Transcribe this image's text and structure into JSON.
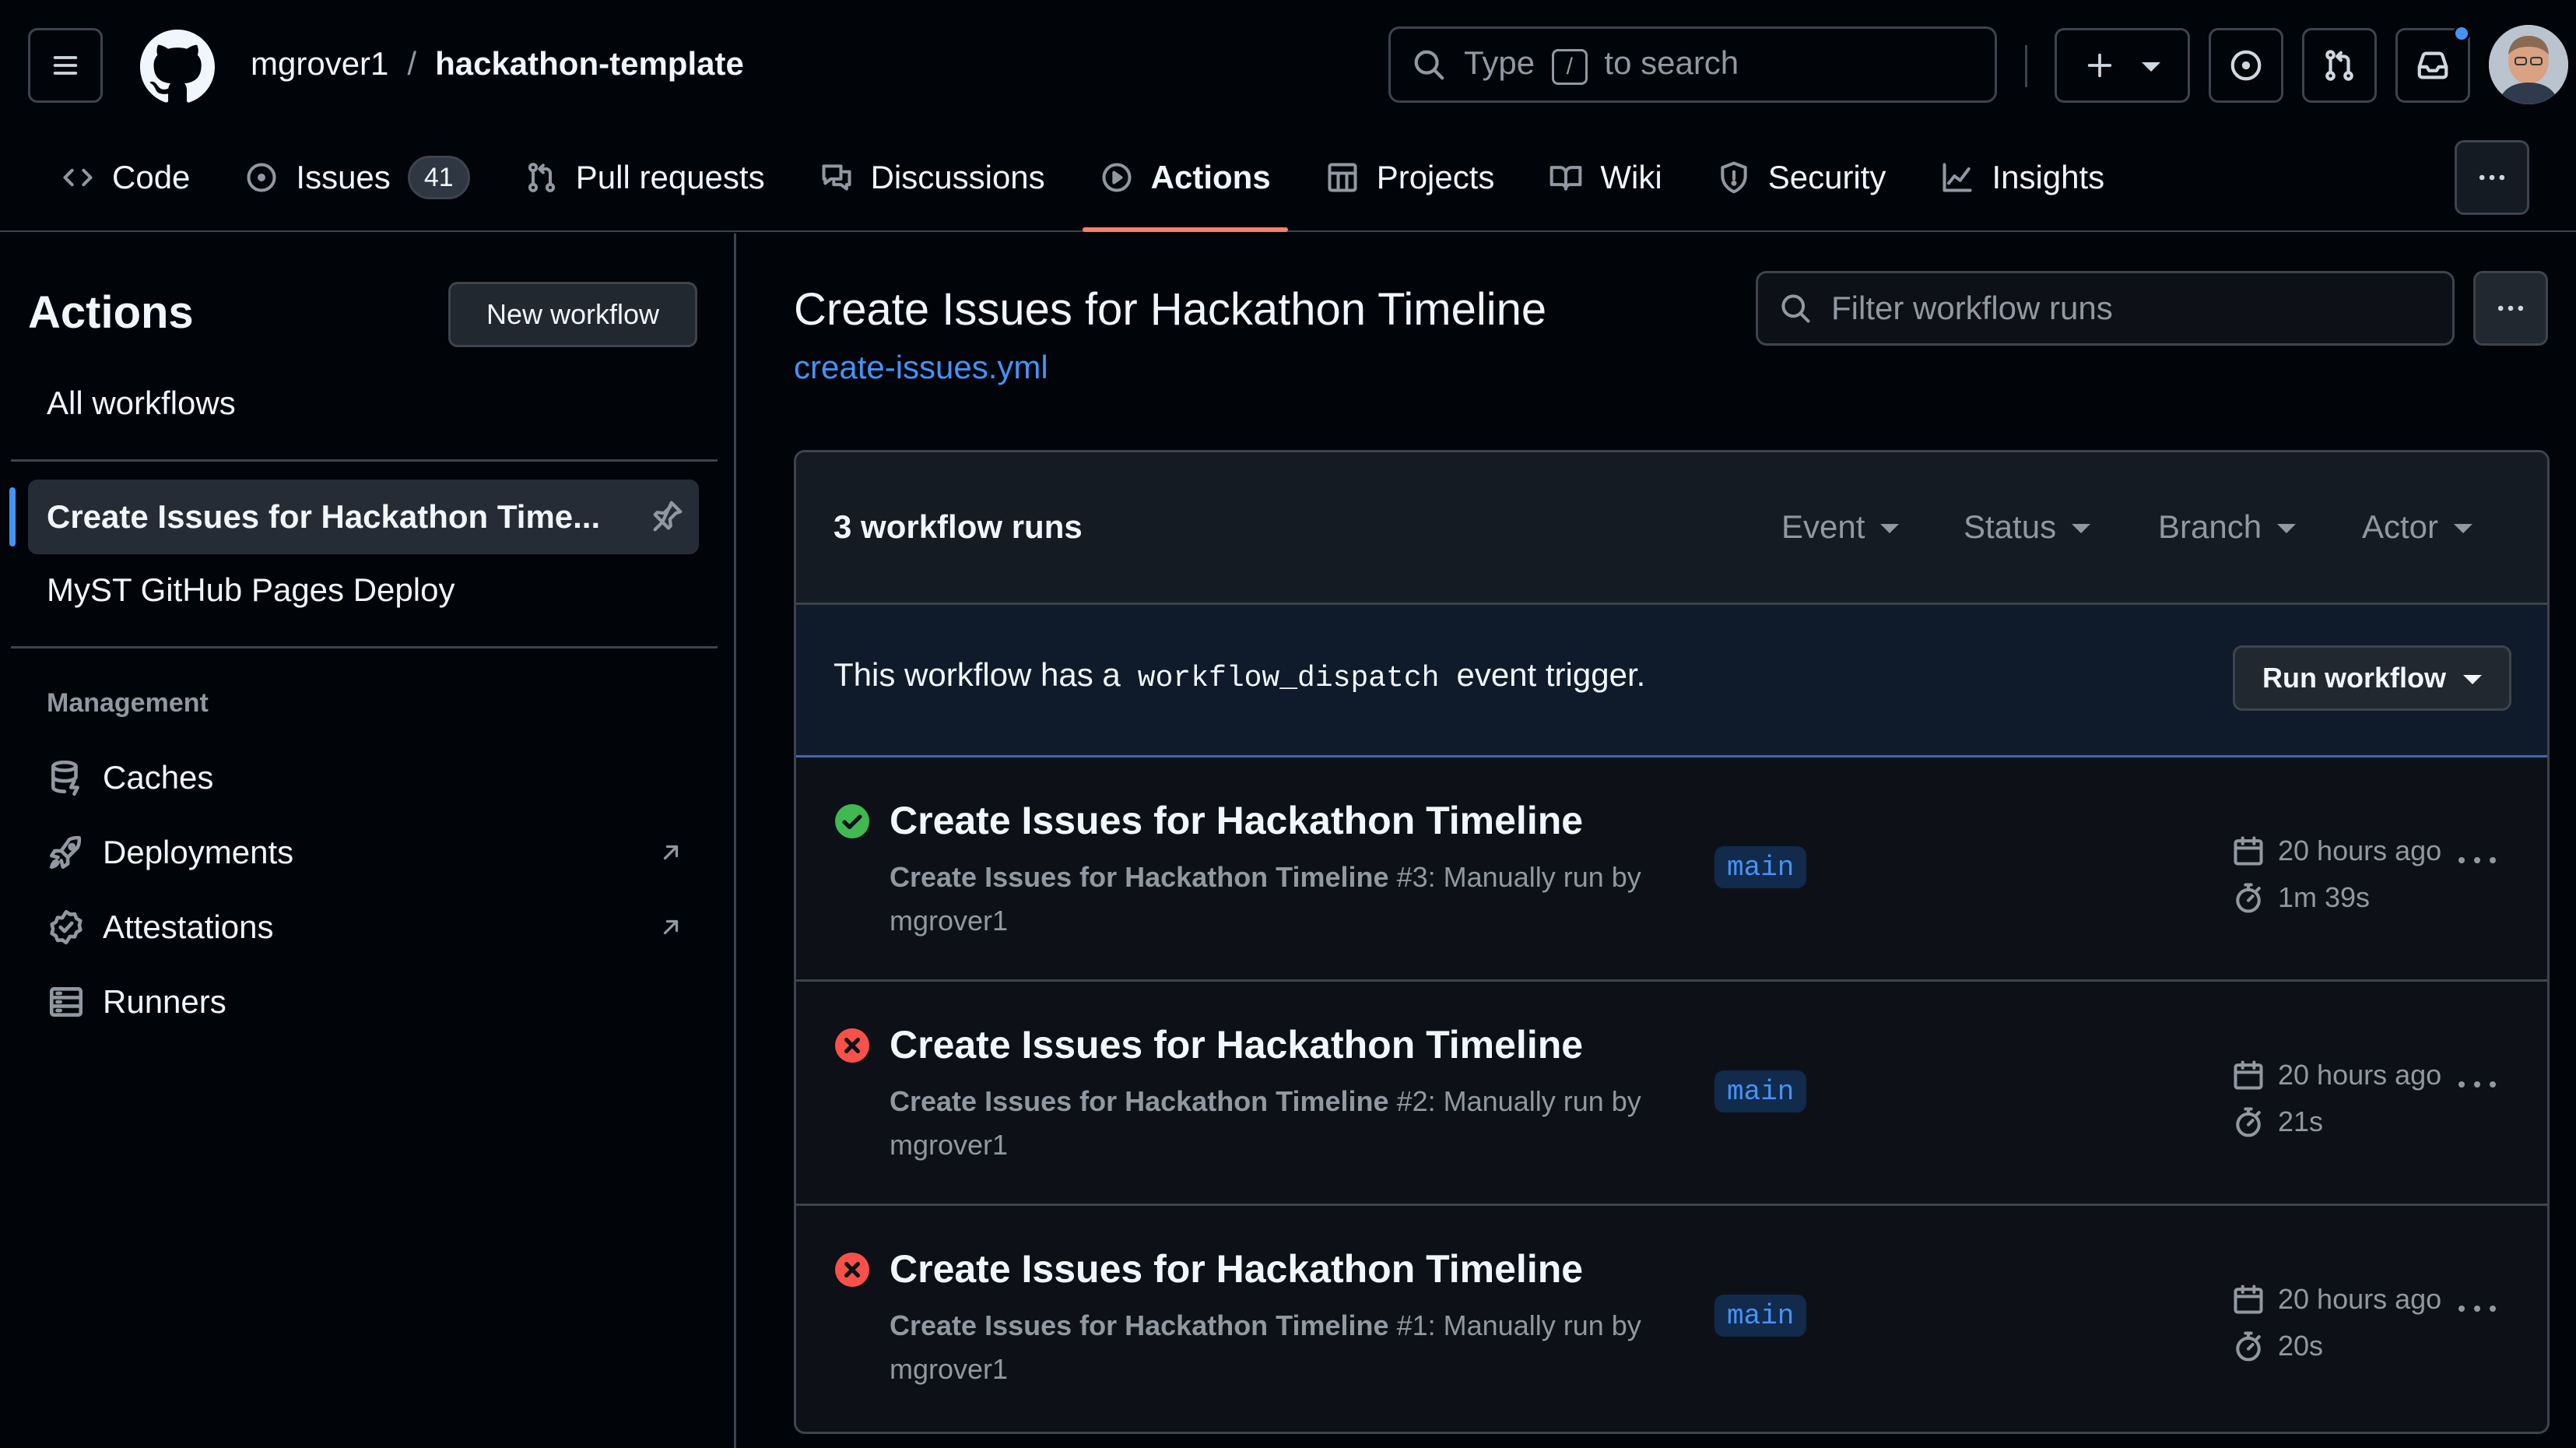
{
  "header": {
    "owner": "mgrover1",
    "separator": "/",
    "repo": "hackathon-template",
    "search": {
      "before": "Type",
      "key": "/",
      "after": "to search"
    }
  },
  "nav": {
    "tabs": [
      {
        "label": "Code",
        "icon": "code-icon"
      },
      {
        "label": "Issues",
        "icon": "issue-icon",
        "count": "41"
      },
      {
        "label": "Pull requests",
        "icon": "pull-request-icon"
      },
      {
        "label": "Discussions",
        "icon": "discussions-icon"
      },
      {
        "label": "Actions",
        "icon": "play-icon",
        "active": true
      },
      {
        "label": "Projects",
        "icon": "table-icon"
      },
      {
        "label": "Wiki",
        "icon": "book-icon"
      },
      {
        "label": "Security",
        "icon": "shield-icon"
      },
      {
        "label": "Insights",
        "icon": "graph-icon"
      }
    ]
  },
  "sidebar": {
    "title": "Actions",
    "new_workflow": "New workflow",
    "all_workflows": "All workflows",
    "workflows": [
      {
        "label": "Create Issues for Hackathon Time...",
        "active": true
      },
      {
        "label": "MyST GitHub Pages Deploy"
      }
    ],
    "management_label": "Management",
    "management": [
      {
        "label": "Caches",
        "icon": "cache-icon"
      },
      {
        "label": "Deployments",
        "icon": "rocket-icon",
        "external": true
      },
      {
        "label": "Attestations",
        "icon": "verified-icon",
        "external": true
      },
      {
        "label": "Runners",
        "icon": "server-icon"
      }
    ]
  },
  "main": {
    "title": "Create Issues for Hackathon Timeline",
    "file": "create-issues.yml",
    "filter_placeholder": "Filter workflow runs",
    "runs_count": "3 workflow runs",
    "filters": [
      "Event",
      "Status",
      "Branch",
      "Actor"
    ],
    "dispatch": {
      "before": "This workflow has a",
      "code": "workflow_dispatch",
      "after": "event trigger."
    },
    "run_workflow": "Run workflow",
    "runs": [
      {
        "status": "success",
        "title": "Create Issues for Hackathon Timeline",
        "workflow": "Create Issues for Hackathon Timeline",
        "desc": "#3: Manually run by mgrover1",
        "branch": "main",
        "when": "20 hours ago",
        "duration": "1m 39s"
      },
      {
        "status": "failure",
        "title": "Create Issues for Hackathon Timeline",
        "workflow": "Create Issues for Hackathon Timeline",
        "desc": "#2: Manually run by mgrover1",
        "branch": "main",
        "when": "20 hours ago",
        "duration": "21s"
      },
      {
        "status": "failure",
        "title": "Create Issues for Hackathon Timeline",
        "workflow": "Create Issues for Hackathon Timeline",
        "desc": "#1: Manually run by mgrover1",
        "branch": "main",
        "when": "20 hours ago",
        "duration": "20s"
      }
    ]
  },
  "colors": {
    "accent": "#4493f8",
    "active_tab_underline": "#f78166",
    "success": "#3fb950",
    "failure": "#f85149"
  }
}
